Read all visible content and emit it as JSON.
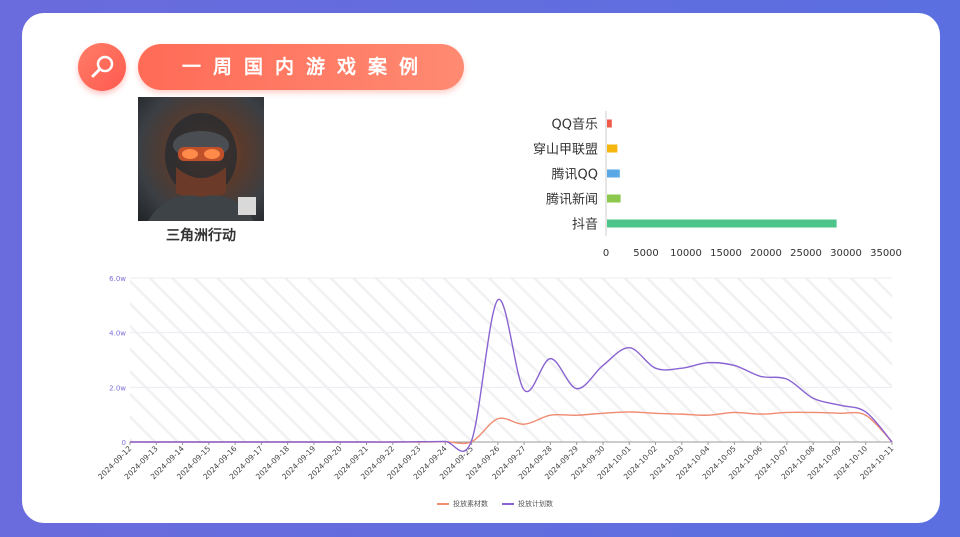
{
  "header": {
    "title": "一周国内游戏案例"
  },
  "game": {
    "name": "三角洲行动"
  },
  "icons": {
    "header": "search-icon"
  },
  "colors": {
    "accent": "#ff6b57",
    "line_materials": "#f08a70",
    "line_plans": "#8a63d2"
  },
  "chart_data": [
    {
      "type": "bar",
      "orientation": "horizontal",
      "categories": [
        "QQ音乐",
        "穿山甲联盟",
        "腾讯QQ",
        "腾讯新闻",
        "抖音"
      ],
      "values": [
        600,
        1300,
        1600,
        1700,
        28700
      ],
      "colors": [
        "#f05a4a",
        "#f5b60f",
        "#5aa9e6",
        "#8cc84b",
        "#4cc48a"
      ],
      "xlim": [
        0,
        35000
      ],
      "xticks": [
        "0",
        "5000",
        "10000",
        "15000",
        "20000",
        "25000",
        "30000",
        "35000"
      ]
    },
    {
      "type": "line",
      "x": [
        "2024-09-12",
        "2024-09-13",
        "2024-09-14",
        "2024-09-15",
        "2024-09-16",
        "2024-09-17",
        "2024-09-18",
        "2024-09-19",
        "2024-09-20",
        "2024-09-21",
        "2024-09-22",
        "2024-09-23",
        "2024-09-24",
        "2024-09-25",
        "2024-09-26",
        "2024-09-27",
        "2024-09-28",
        "2024-09-29",
        "2024-09-30",
        "2024-10-01",
        "2024-10-02",
        "2024-10-03",
        "2024-10-04",
        "2024-10-05",
        "2024-10-06",
        "2024-10-07",
        "2024-10-08",
        "2024-10-09",
        "2024-10-10",
        "2024-10-11"
      ],
      "series": [
        {
          "name": "投放素材数",
          "color": "#f08a70",
          "values": [
            0,
            0,
            0,
            0,
            0,
            0,
            0,
            0,
            0,
            0,
            0,
            0,
            100,
            100,
            8500,
            6500,
            9800,
            9800,
            10500,
            11000,
            10500,
            10200,
            9800,
            10800,
            10200,
            10800,
            10800,
            10500,
            9800,
            0
          ]
        },
        {
          "name": "投放计划数",
          "color": "#8a63d2",
          "values": [
            0,
            0,
            0,
            0,
            0,
            0,
            0,
            0,
            0,
            0,
            0,
            100,
            200,
            500,
            52000,
            19000,
            30500,
            19500,
            28000,
            34500,
            27000,
            27000,
            29000,
            28000,
            24000,
            23000,
            16000,
            13500,
            11000,
            0
          ]
        }
      ],
      "ylim": [
        0,
        60000
      ],
      "yticks": [
        "0",
        "2.0w",
        "4.0w",
        "6.0w"
      ]
    }
  ]
}
